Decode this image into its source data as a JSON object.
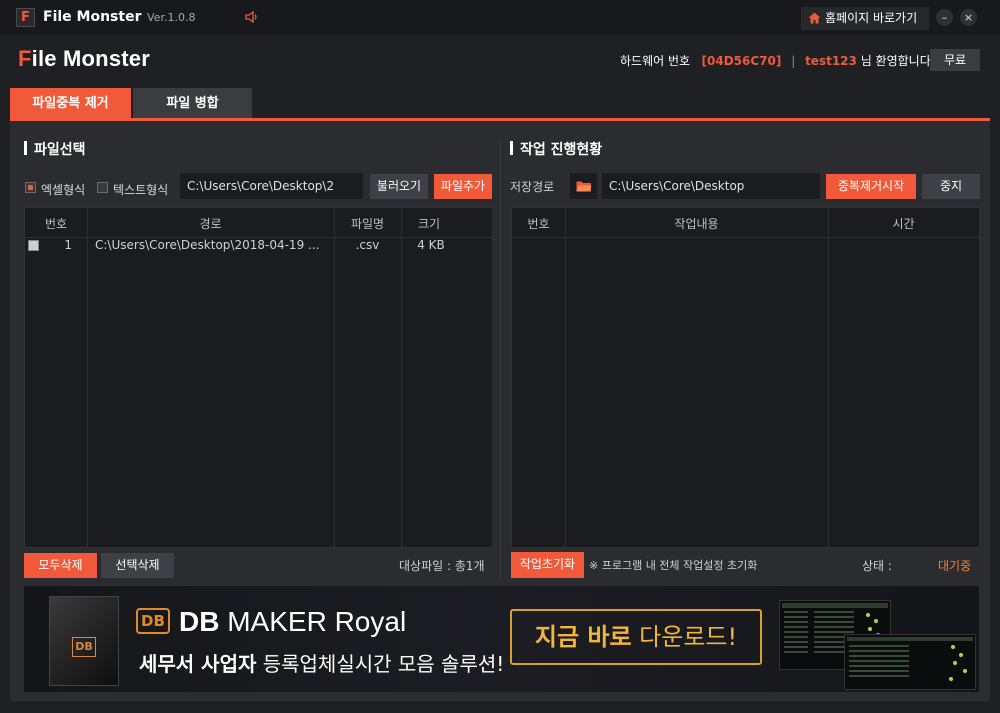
{
  "titlebar": {
    "logo_letter": "F",
    "app_name": "File Monster",
    "version": "Ver.1.0.8",
    "home_button": "홈페이지 바로가기",
    "minimize": "–",
    "close": "×"
  },
  "header": {
    "brand_first": "F",
    "brand_rest": "ile Monster",
    "hardware_label": "하드웨어 번호",
    "hardware_id": "[04D56C70]",
    "separator": "|",
    "user_id": "test123",
    "welcome": "님 환영합니다.",
    "plan_button": "무료"
  },
  "tabs": [
    {
      "label": "파일중복 제거",
      "active": true
    },
    {
      "label": "파일 병합",
      "active": false
    }
  ],
  "left": {
    "title": "파일선택",
    "format_options": [
      {
        "label": "엑셀형식",
        "checked": true
      },
      {
        "label": "텍스트형식",
        "checked": false
      }
    ],
    "path": "C:\\Users\\Core\\Desktop\\2",
    "load_button": "불러오기",
    "add_button": "파일추가",
    "columns": [
      "번호",
      "경로",
      "파일명",
      "크기"
    ],
    "rows": [
      {
        "no": "1",
        "path": "C:\\Users\\Core\\Desktop\\2018-04-19 ...",
        "filename": ".csv",
        "size": "4 KB"
      }
    ],
    "delete_all": "모두삭제",
    "delete_selected": "선택삭제",
    "target_label": "대상파일 : ",
    "target_count": "총1개"
  },
  "right": {
    "title": "작업 진행현황",
    "save_label": "저장경로",
    "save_path": "C:\\Users\\Core\\Desktop",
    "start_button": "중복제거시작",
    "stop_button": "중지",
    "columns": [
      "번호",
      "작업내용",
      "시간"
    ],
    "reset_button": "작업초기화",
    "reset_note": "※ 프로그램 내 전체 작업설정 초기화",
    "status_label": "상태 :",
    "status_value": "대기중"
  },
  "banner": {
    "box_logo": "DB",
    "logo": "DB",
    "title_bold": "DB",
    "title_rest": " MAKER Royal",
    "sub_bold": "세무서 사업자",
    "sub_rest": " 등록업체실시간 모음 솔루션!",
    "cta_bold": "지금 바로",
    "cta_rest": " 다운로드!"
  },
  "colors": {
    "accent": "#f05a3a",
    "panel": "#2a2c30",
    "background": "#1e2024"
  }
}
